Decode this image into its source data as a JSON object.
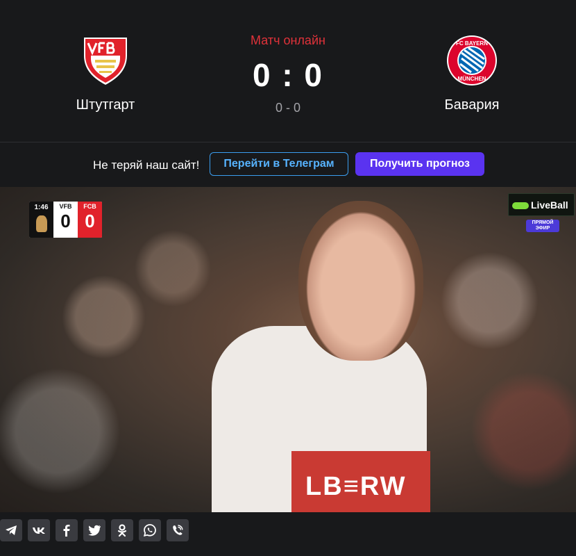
{
  "match": {
    "home": {
      "name": "Штутгарт",
      "logo_icon": "vfb-stuttgart-crest-icon"
    },
    "away": {
      "name": "Бавария",
      "logo_icon": "fc-bayern-munchen-crest-icon"
    },
    "status": "Матч онлайн",
    "score": "0 : 0",
    "half_score": "0 - 0"
  },
  "promo": {
    "text": "Не теряй наш сайт!",
    "telegram_button": "Перейти в Телеграм",
    "forecast_button": "Получить прогноз"
  },
  "video": {
    "scorebug": {
      "clock": "1:46",
      "home_abbr": "VFB",
      "home_score": "0",
      "away_abbr": "FCB",
      "away_score": "0"
    },
    "brand": "LiveBall",
    "live_badge": "ПРЯМОЙ ЭФИР",
    "shirt_text": "LB≡RW"
  },
  "share": [
    {
      "icon": "telegram-icon"
    },
    {
      "icon": "vk-icon"
    },
    {
      "icon": "facebook-icon"
    },
    {
      "icon": "twitter-icon"
    },
    {
      "icon": "odnoklassniki-icon"
    },
    {
      "icon": "whatsapp-icon"
    },
    {
      "icon": "viber-icon"
    }
  ],
  "colors": {
    "background": "#18191b",
    "status_red": "#e0323a",
    "telegram_blue": "#3b9ef0",
    "forecast_purple": "#5a33f0",
    "share_button_bg": "#3a3b40"
  }
}
